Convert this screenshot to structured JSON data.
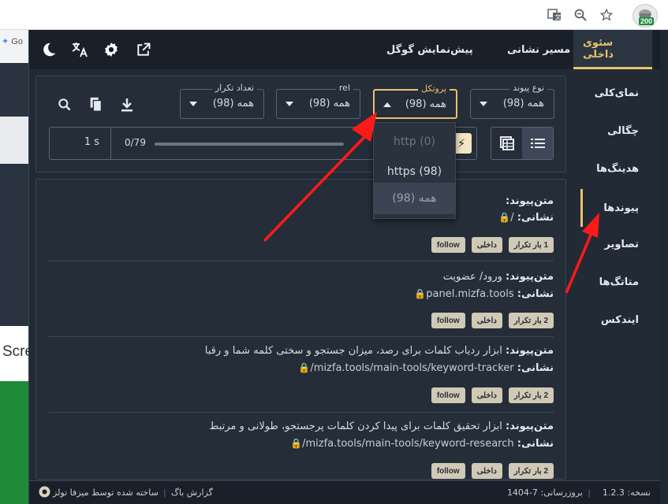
{
  "browser": {
    "omnibox_partial": "Go",
    "extension_badge": "200"
  },
  "background_page": {
    "side_text": "Scre"
  },
  "topbar": {
    "tabs": [
      {
        "label": "سئوی داخلی",
        "active": true
      },
      {
        "label": "مسیر نشانی",
        "active": false
      },
      {
        "label": "پیش‌نمایش گوگل",
        "active": false
      }
    ]
  },
  "sidebar": {
    "items": [
      {
        "label": "نمای‌کلی",
        "active": false
      },
      {
        "label": "چگالی",
        "active": false
      },
      {
        "label": "هدینگ‌ها",
        "active": false
      },
      {
        "label": "پیوندها",
        "active": true
      },
      {
        "label": "تصاویر",
        "active": false
      },
      {
        "label": "متاتگ‌ها",
        "active": false
      },
      {
        "label": "ایندکس",
        "active": false
      }
    ]
  },
  "filters": {
    "link_type": {
      "label": "نوع پیوند",
      "value": "همه (98)"
    },
    "protocol": {
      "label": "پروتکل",
      "value": "همه (98)"
    },
    "rel": {
      "label": "rel",
      "value": "همه (98)"
    },
    "repeat_count": {
      "label": "تعداد تکرار",
      "value": "همه (98)"
    }
  },
  "protocol_menu": {
    "options": [
      {
        "label": "http (0)",
        "state": "disabled"
      },
      {
        "label": "https (98)",
        "state": "normal"
      },
      {
        "label": "همه (98)",
        "state": "selected"
      }
    ]
  },
  "player": {
    "interval": "1 s",
    "progress_text": "0/79",
    "progress_fraction": 0
  },
  "links": [
    {
      "anchor_label": "متن‌پیوند:",
      "anchor_text": "",
      "target_label": "نشانی:",
      "url": "/",
      "badges": [
        "1 بار تکرار",
        "داخلی",
        "follow"
      ]
    },
    {
      "anchor_label": "متن‌پیوند:",
      "anchor_text": "ورود/ عضویت",
      "target_label": "نشانی:",
      "url": "panel.mizfa.tools",
      "badges": [
        "2 بار تکرار",
        "داخلی",
        "follow"
      ]
    },
    {
      "anchor_label": "متن‌پیوند:",
      "anchor_text": "ابزار ردیاب کلمات برای رصد، میزان جستجو و سختی کلمه شما و رقبا",
      "target_label": "نشانی:",
      "url": "mizfa.tools/main-tools/keyword-tracker/",
      "badges": [
        "2 بار تکرار",
        "داخلی",
        "follow"
      ]
    },
    {
      "anchor_label": "متن‌پیوند:",
      "anchor_text": "ابزار تحقیق کلمات برای پیدا کردن کلمات پرجستجو، طولانی و مرتبط",
      "target_label": "نشانی:",
      "url": "mizfa.tools/main-tools/keyword-research/",
      "badges": [
        "2 بار تکرار",
        "داخلی",
        "follow"
      ]
    }
  ],
  "footer": {
    "version": "نسخه: 1.2.3",
    "updated": "بروزرسانی: 7-1404",
    "bug_report": "گزارش باگ",
    "credit": "ساخته شده توسط میزفا تولز"
  },
  "colors": {
    "accent": "#e8c26a",
    "panel_bg": "#222a35",
    "topbar_bg": "#1a2029",
    "badge_bg": "#cfc9b6",
    "lock_green": "#3aa655",
    "annotation_arrow": "#ff1a1a"
  }
}
